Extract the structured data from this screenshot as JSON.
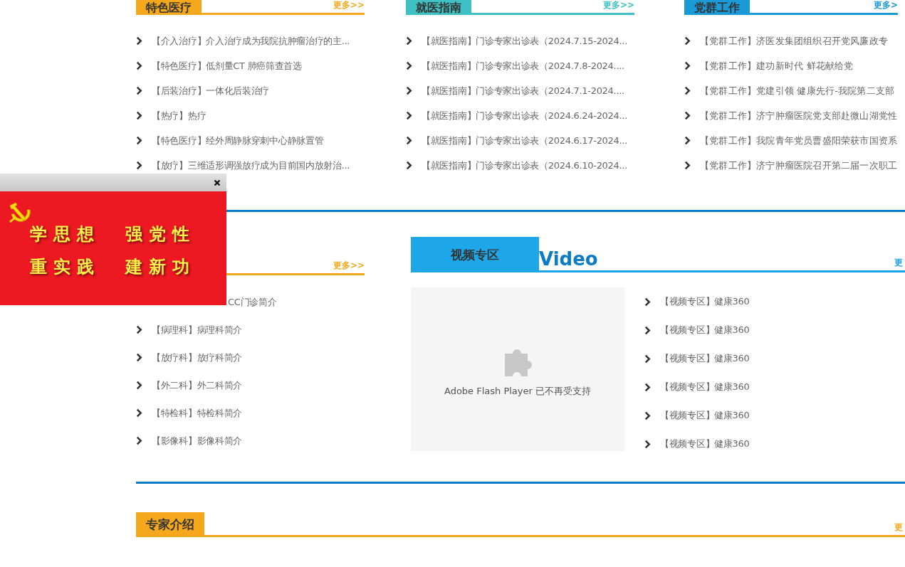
{
  "top_columns": [
    {
      "title": "特色医疗",
      "color": "#f5a81c",
      "more": "更多>>",
      "items": [
        "【介入治疗】介入治疗成为我院抗肿瘤治疗的主...",
        "【特色医疗】低剂量CT 肺癌筛查首选",
        "【后装治疗】一体化后装治疗",
        "【热疗】热疗",
        "【特色医疗】经外周静脉穿刺中心静脉置管",
        "【放疗】三维适形调强放疗成为目前国内放射治..."
      ]
    },
    {
      "title": "就医指南",
      "color": "#3fc1c3",
      "more": "更多>>",
      "items": [
        "【就医指南】门诊专家出诊表（2024.7.15-2024...",
        "【就医指南】门诊专家出诊表（2024.7.8-2024....",
        "【就医指南】门诊专家出诊表（2024.7.1-2024....",
        "【就医指南】门诊专家出诊表（2024.6.24-2024...",
        "【就医指南】门诊专家出诊表（2024.6.17-2024...",
        "【就医指南】门诊专家出诊表（2024.6.10-2024..."
      ]
    },
    {
      "title": "党群工作",
      "color": "#1a9ad6",
      "more": "更多>",
      "items": [
        "【党群工作】济医发集团组织召开党风廉政专",
        "【党群工作】建功新时代 鲜花献给党",
        "【党群工作】党建引领 健康先行-我院第二支部",
        "【党群工作】济宁肿瘤医院党支部赴微山湖党性",
        "【党群工作】我院青年党员曹盛阳荣获市国资系",
        "【党群工作】济宁肿瘤医院召开第二届一次职工"
      ]
    }
  ],
  "departments": {
    "more": "更多>>",
    "items": [
      "CC门诊简介",
      "【病理科】病理科简介",
      "【放疗科】放疗科简介",
      "【外二科】外二科简介",
      "【特检科】特检科简介",
      "【影像科】影像科简介"
    ]
  },
  "video": {
    "title": "视频专区",
    "subtitle": "Video",
    "more": "更",
    "player_message": "Adobe Flash Player 已不再受支持",
    "items": [
      "【视频专区】健康360",
      "【视频专区】健康360",
      "【视频专区】健康360",
      "【视频专区】健康360",
      "【视频专区】健康360",
      "【视频专区】健康360"
    ]
  },
  "experts": {
    "title": "专家介绍",
    "more": "更"
  },
  "popup": {
    "lines": [
      "学思想  强党性",
      "重实践  建新功"
    ]
  }
}
